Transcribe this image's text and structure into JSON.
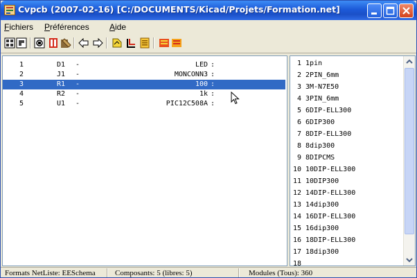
{
  "window": {
    "title": "Cvpcb (2007-02-16) [C:/DOCUMENTS/Kicad/Projets/Formation.net]"
  },
  "menu": {
    "fichiers": {
      "underlined": "F",
      "rest": "ichiers"
    },
    "preferences": {
      "underlined": "P",
      "rest": "références"
    },
    "aide": {
      "underlined": "A",
      "rest": "ide"
    }
  },
  "toolbar_icons": [
    "open-netlist-icon",
    "save-netlist-icon",
    "library-icon",
    "config-icon",
    "footprint-view-icon",
    "prev-arrow-icon",
    "next-arrow-icon",
    "auto-assoc-icon",
    "delete-assoc-icon",
    "doc-icon",
    "filter-icon",
    "filter-all-icon"
  ],
  "components": [
    {
      "num": "1",
      "ref": "D1",
      "dash": "-",
      "value": "LED",
      "colon": ":",
      "footprint": ""
    },
    {
      "num": "2",
      "ref": "J1",
      "dash": "-",
      "value": "MONCONN3",
      "colon": ":",
      "footprint": ""
    },
    {
      "num": "3",
      "ref": "R1",
      "dash": "-",
      "value": "100",
      "colon": ":",
      "footprint": ""
    },
    {
      "num": "4",
      "ref": "R2",
      "dash": "-",
      "value": "1k",
      "colon": ":",
      "footprint": ""
    },
    {
      "num": "5",
      "ref": "U1",
      "dash": "-",
      "value": "PIC12C508A",
      "colon": ":",
      "footprint": ""
    }
  ],
  "selected_component_index": 2,
  "modules": [
    {
      "num": "1",
      "name": "1pin"
    },
    {
      "num": "2",
      "name": "2PIN_6mm"
    },
    {
      "num": "3",
      "name": "3M-N7E50"
    },
    {
      "num": "4",
      "name": "3PIN_6mm"
    },
    {
      "num": "5",
      "name": "6DIP-ELL300"
    },
    {
      "num": "6",
      "name": "6DIP300"
    },
    {
      "num": "7",
      "name": "8DIP-ELL300"
    },
    {
      "num": "8",
      "name": "8dip300"
    },
    {
      "num": "9",
      "name": "8DIPCMS"
    },
    {
      "num": "10",
      "name": "10DIP-ELL300"
    },
    {
      "num": "11",
      "name": "10DIP300"
    },
    {
      "num": "12",
      "name": "14DIP-ELL300"
    },
    {
      "num": "13",
      "name": "14dip300"
    },
    {
      "num": "14",
      "name": "16DIP-ELL300"
    },
    {
      "num": "15",
      "name": "16dip300"
    },
    {
      "num": "16",
      "name": "18DIP-ELL300"
    },
    {
      "num": "17",
      "name": "18dip300"
    },
    {
      "num": "18",
      "name": ""
    }
  ],
  "status": {
    "format": "Formats NetListe: EESchema",
    "components": "Composants: 5 (libres: 5)",
    "modules": "Modules (Tous): 360"
  },
  "colors": {
    "selection": "#316ac5",
    "titlebar": "#1c5ad8",
    "chrome": "#ece9d8"
  }
}
